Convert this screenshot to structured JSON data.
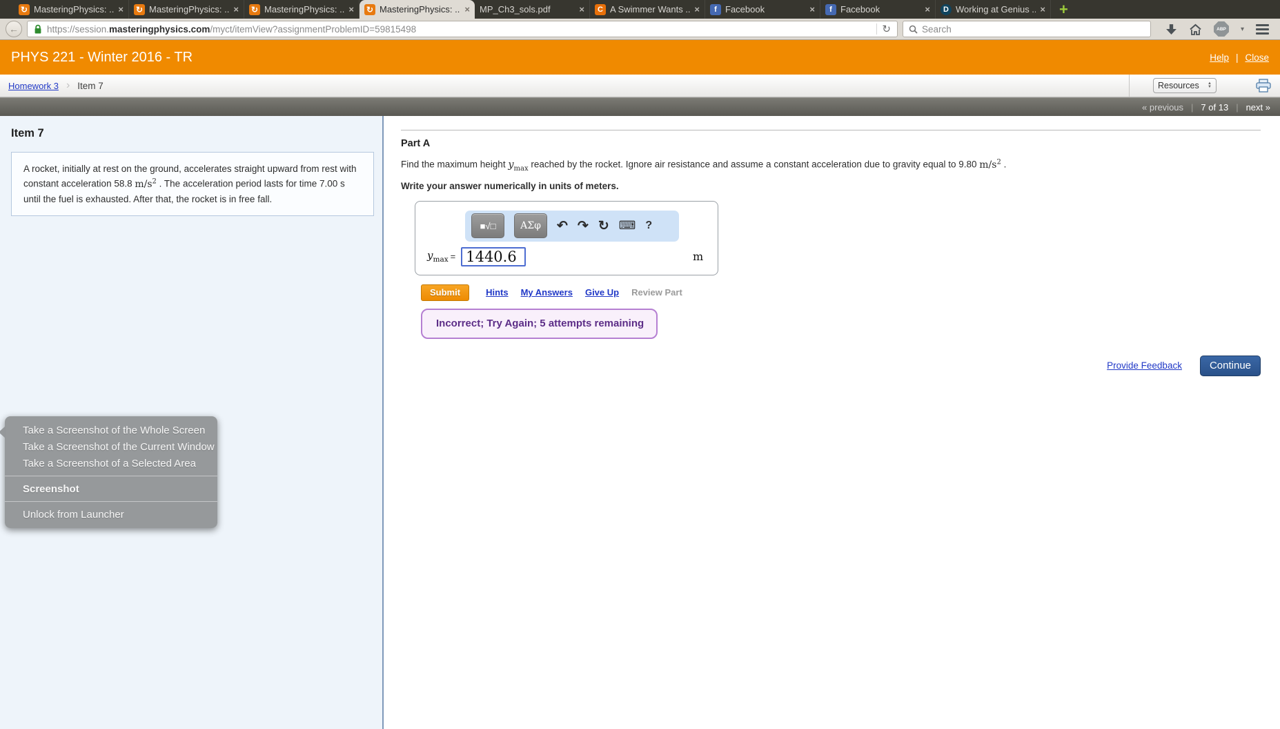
{
  "browser": {
    "tabs": [
      {
        "label": "MasteringPhysics: ...",
        "glyph": "↻"
      },
      {
        "label": "MasteringPhysics: ...",
        "glyph": "↻"
      },
      {
        "label": "MasteringPhysics: ...",
        "glyph": "↻"
      },
      {
        "label": "MasteringPhysics: ...",
        "glyph": "↻"
      },
      {
        "label": "MP_Ch3_sols.pdf",
        "glyph": ""
      },
      {
        "label": "A Swimmer Wants ...",
        "glyph": "C"
      },
      {
        "label": "Facebook",
        "glyph": "f"
      },
      {
        "label": "Facebook",
        "glyph": "f"
      },
      {
        "label": "Working at Genius ...",
        "glyph": "D"
      }
    ],
    "tab_close": "×",
    "new_tab": "+",
    "back_glyph": "←",
    "url": {
      "prefix": "https://session.",
      "domain": "masteringphysics.com",
      "path": "/myct/itemView?assignmentProblemID=59815498"
    },
    "reload_glyph": "↻",
    "search_placeholder": "Search",
    "abp_label": "ABP",
    "abp_caret": "▾"
  },
  "course_header": {
    "title": "PHYS 221 - Winter 2016 - TR",
    "help": "Help",
    "divider": "|",
    "close": "Close"
  },
  "breadcrumb": {
    "homework_link": "Homework 3",
    "chevron": "›",
    "current": "Item 7",
    "resources": "Resources",
    "stepper_up": "▲",
    "stepper_down": "▼"
  },
  "pager": {
    "previous": "« previous",
    "sep": "|",
    "position": "7 of 13",
    "next": "next »"
  },
  "item_panel": {
    "title": "Item 7",
    "p1": "A rocket, initially at rest on the ground, accelerates straight upward from rest with constant acceleration 58.8 ",
    "unit": "m/s",
    "unit_sup": "2",
    "p2": " . The acceleration period lasts for time 7.00 s until the fuel is exhausted. After that, the rocket is in free fall."
  },
  "part_a": {
    "label": "Part A",
    "q1": "Find the maximum height ",
    "var": "y",
    "var_sub": "max",
    "q2": " reached by the rocket. Ignore air resistance and assume a constant acceleration due to gravity equal to 9.80 ",
    "unit": "m/s",
    "unit_sup": "2",
    "q3": " .",
    "instruction": "Write your answer numerically in units of meters."
  },
  "answer": {
    "var": "y",
    "var_sub": "max",
    "equals": "=",
    "value": "1440.6",
    "unit": "m",
    "toolbar": {
      "templates": "■√□",
      "greek": "ΑΣφ",
      "undo": "↶",
      "redo": "↷",
      "reset": "↻",
      "keyboard": "⌨",
      "help": "?"
    }
  },
  "actions": {
    "submit": "Submit",
    "hints": "Hints",
    "my_answers": "My Answers",
    "give_up": "Give Up",
    "review_part": "Review Part"
  },
  "feedback": {
    "message": "Incorrect; Try Again; 5 attempts remaining"
  },
  "footer": {
    "provide_feedback": "Provide Feedback",
    "continue_label": "Continue"
  },
  "launcher_menu": {
    "items": [
      "Take a Screenshot of the Whole Screen",
      "Take a Screenshot of the Current Window",
      "Take a Screenshot of a Selected Area",
      "Screenshot",
      "Unlock from Launcher"
    ]
  },
  "colors": {
    "header_orange": "#f08a00",
    "link_blue": "#2139c7",
    "incorrect_purple": "#5c2d87",
    "submit_orange": "#ee8b02",
    "continue_blue": "#2a5189",
    "toolbar_blue": "#cfe2f7"
  }
}
